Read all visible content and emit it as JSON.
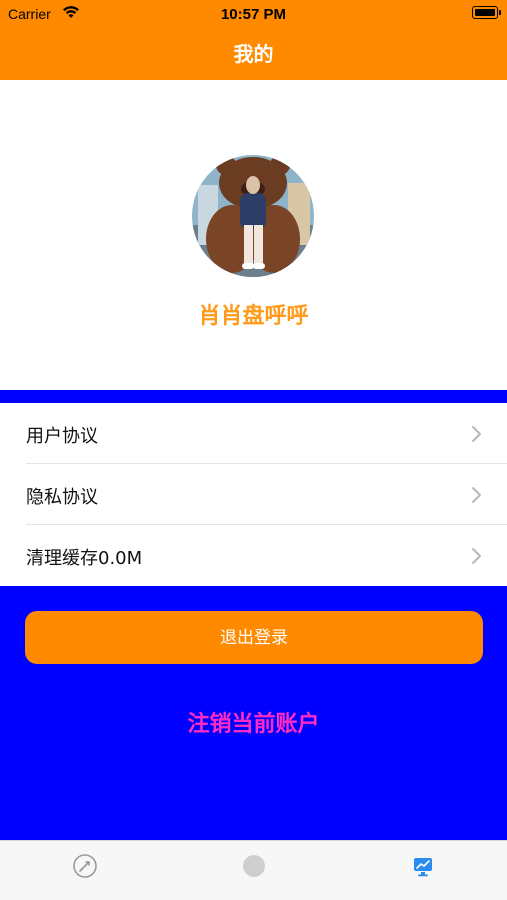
{
  "status_bar": {
    "carrier": "Carrier",
    "time": "10:57 PM"
  },
  "nav": {
    "title": "我的"
  },
  "profile": {
    "username": "肖肖盘呼呼",
    "avatar_icon": "avatar-photo"
  },
  "menu": {
    "items": [
      {
        "label": "用户协议"
      },
      {
        "label": "隐私协议"
      },
      {
        "label": "清理缓存0.0M"
      }
    ]
  },
  "actions": {
    "logout_label": "退出登录",
    "delete_account_label": "注销当前账户"
  },
  "tabbar": {
    "tabs": [
      {
        "icon": "rocket-icon"
      },
      {
        "icon": "circle-icon"
      },
      {
        "icon": "chart-monitor-icon"
      }
    ]
  },
  "colors": {
    "accent": "#ff8a00",
    "background": "#0000ff",
    "delete_text": "#ff2cc4",
    "username": "#ff9a1a"
  }
}
